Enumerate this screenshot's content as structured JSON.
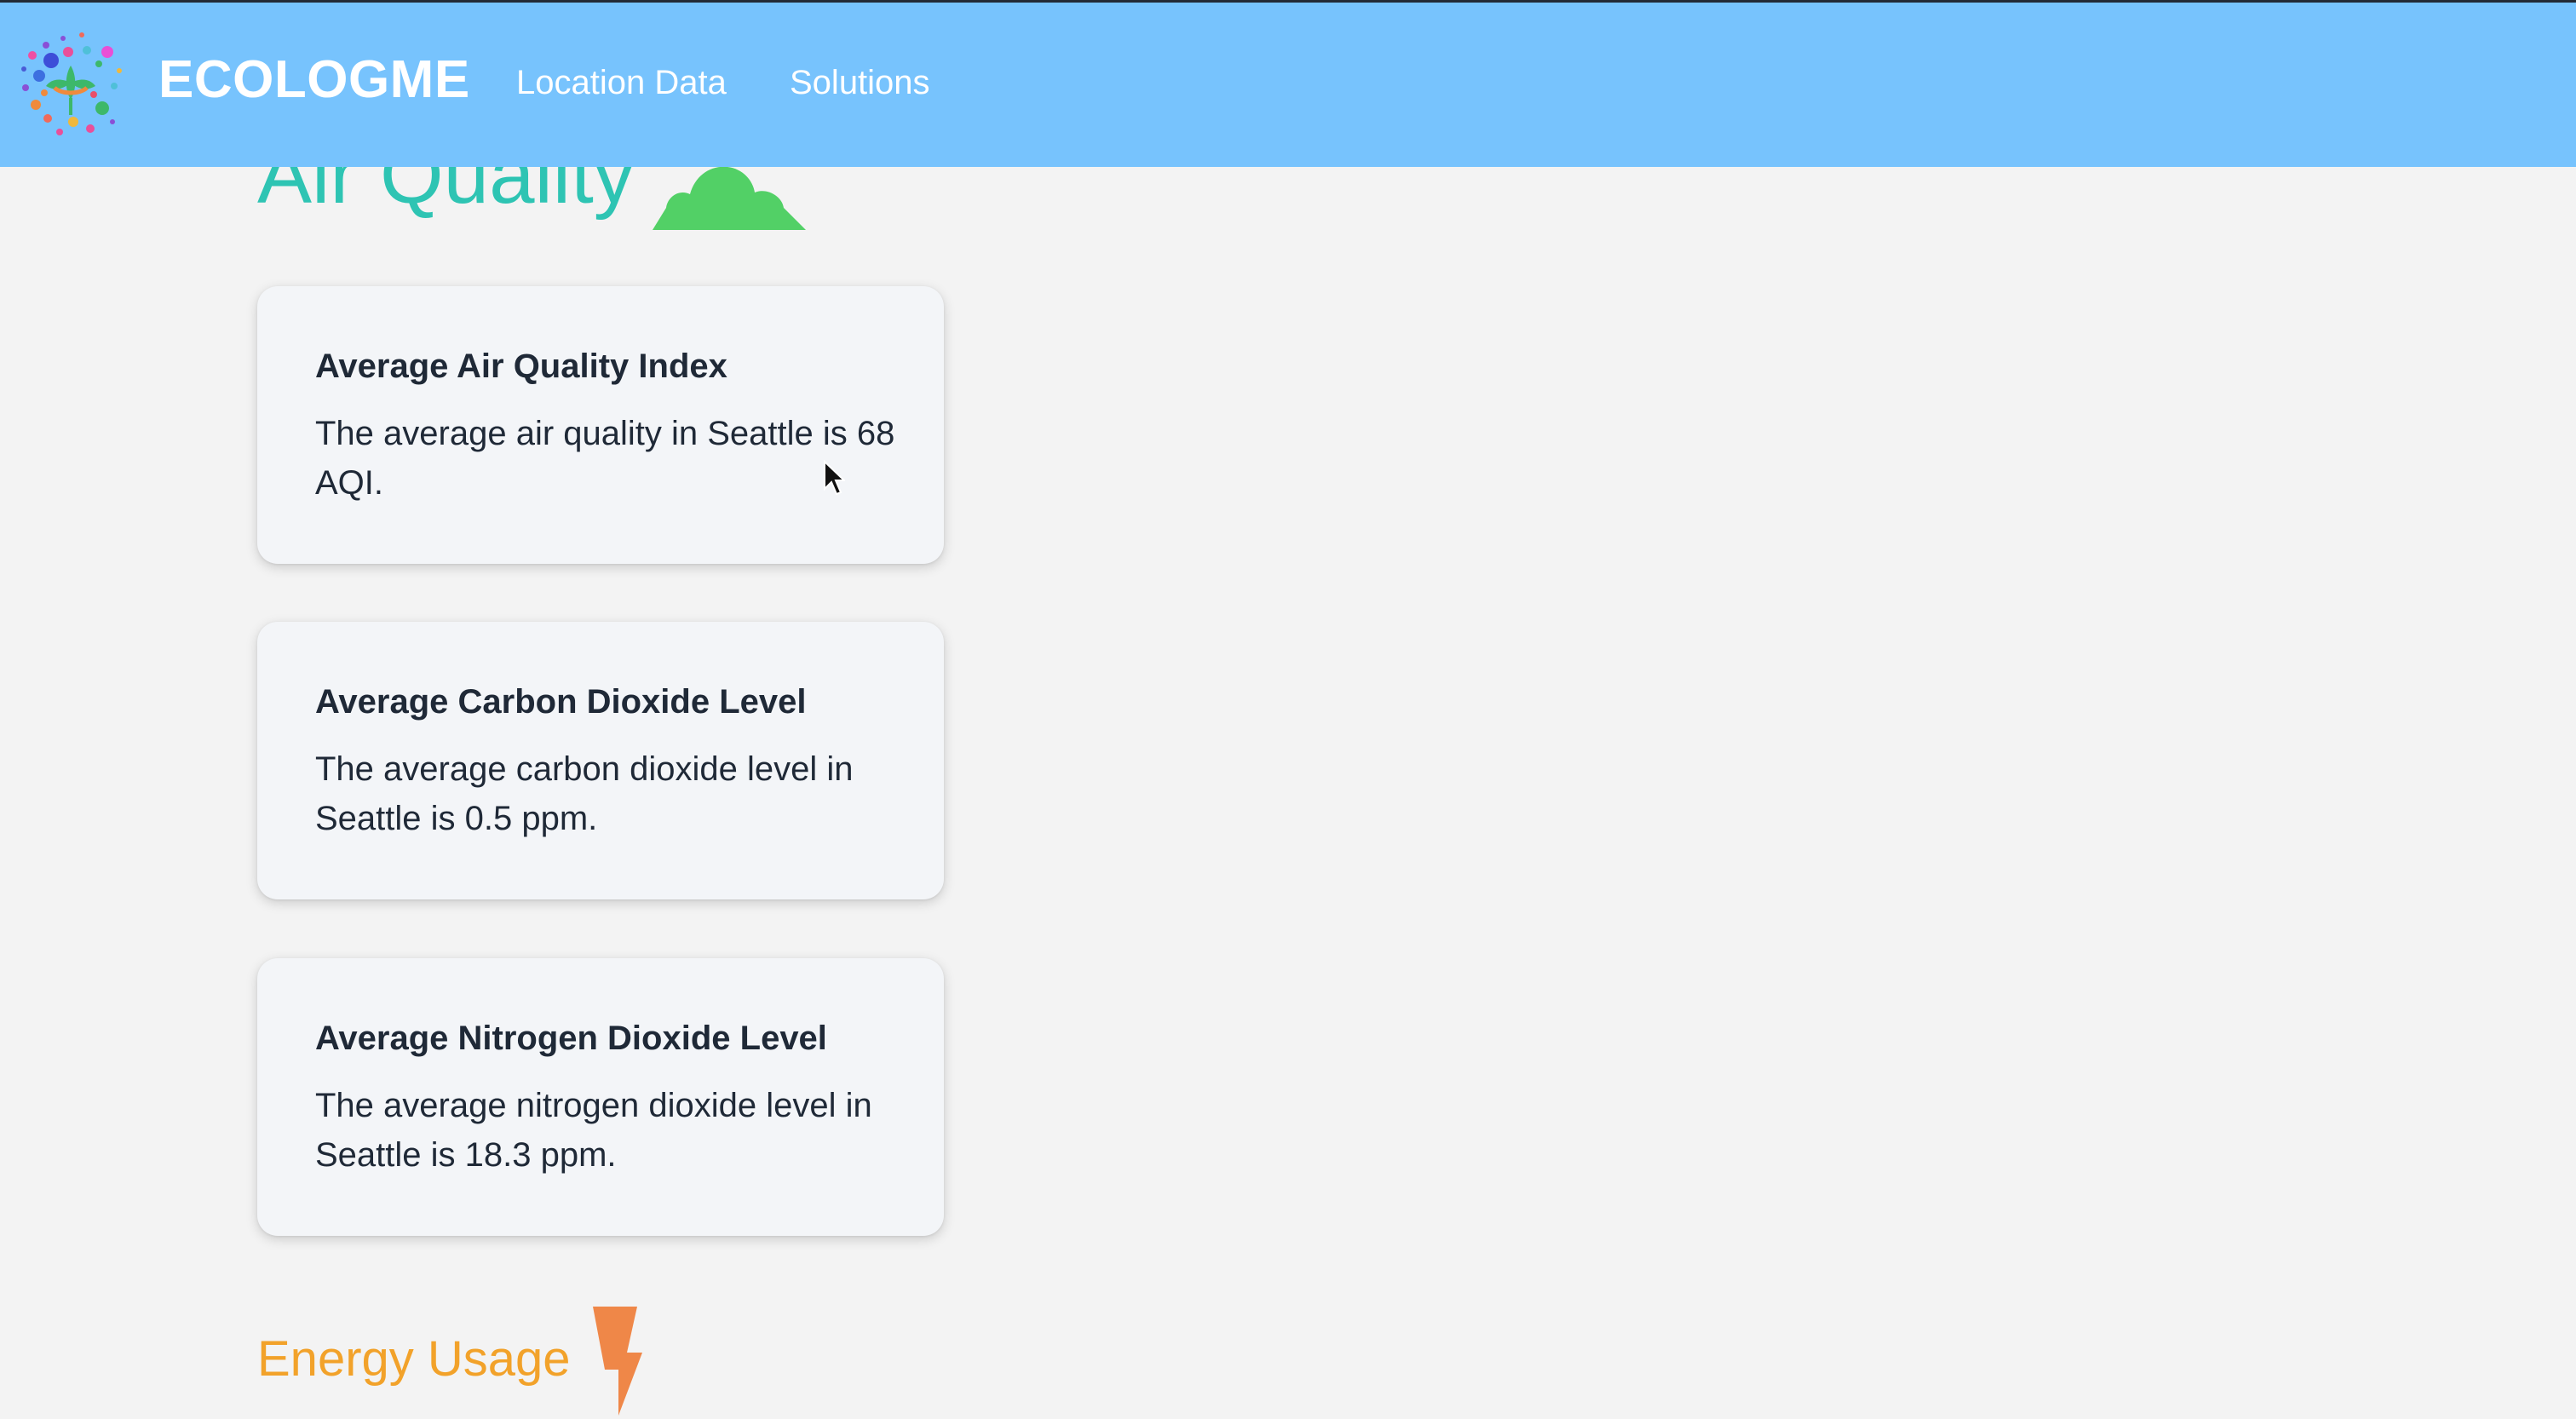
{
  "navbar": {
    "brand": "ECOLOGME",
    "links": [
      {
        "label": "Location Data"
      },
      {
        "label": "Solutions"
      }
    ]
  },
  "air_quality": {
    "heading": "Air Quality",
    "icon": "cloud-icon",
    "cards": [
      {
        "title": "Average Air Quality Index",
        "text": "The average air quality in Seattle is 68 AQI."
      },
      {
        "title": "Average Carbon Dioxide Level",
        "text": "The average carbon dioxide level in Seattle is 0.5 ppm."
      },
      {
        "title": "Average Nitrogen Dioxide Level",
        "text": "The average nitrogen dioxide level in Seattle is 18.3 ppm."
      }
    ]
  },
  "energy_usage": {
    "heading": "Energy Usage",
    "icon": "lightning-bolt-icon"
  },
  "colors": {
    "navbar": "#77c3fd",
    "air_quality_heading": "#2ec4b3",
    "cloud": "#52d066",
    "energy_heading": "#f2a22a",
    "bolt": "#ef8748",
    "card_background": "#f3f5f8",
    "page_background": "#f3f3f3"
  }
}
